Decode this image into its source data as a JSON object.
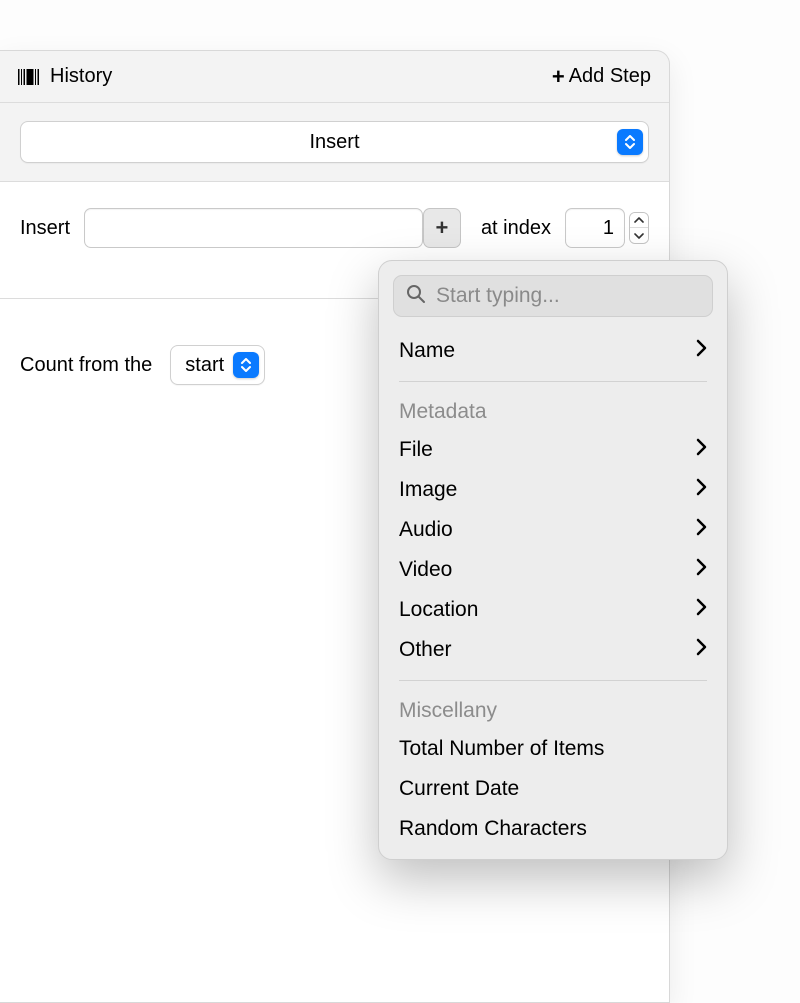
{
  "header": {
    "title": "History",
    "add_step": "Add Step"
  },
  "step": {
    "type_label": "Insert",
    "insert_label": "Insert",
    "insert_value": "",
    "at_index_label": "at index",
    "index_value": "1",
    "count_label": "Count from the",
    "count_direction": "start"
  },
  "popover": {
    "search_placeholder": "Start typing...",
    "top_items": [
      "Name"
    ],
    "metadata_heading": "Metadata",
    "metadata_items": [
      "File",
      "Image",
      "Audio",
      "Video",
      "Location",
      "Other"
    ],
    "misc_heading": "Miscellany",
    "misc_items": [
      "Total Number of Items",
      "Current Date",
      "Random Characters"
    ]
  }
}
